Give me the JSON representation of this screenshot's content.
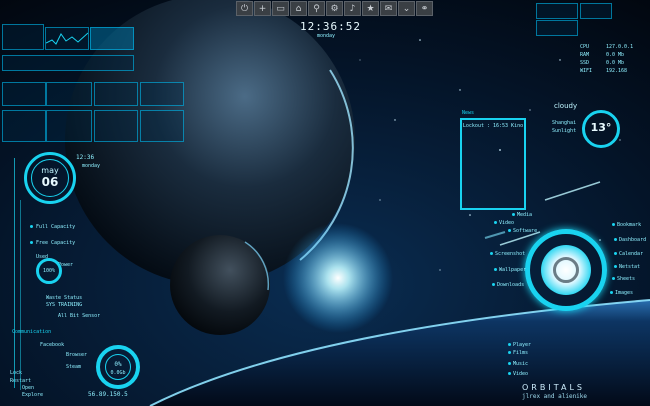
{
  "toolbar": {
    "icons": [
      "power-icon",
      "plus-icon",
      "folder-icon",
      "home-icon",
      "search-icon",
      "gear-icon",
      "music-icon",
      "star-icon",
      "mail-icon",
      "chevron-icon",
      "network-icon"
    ],
    "glyphs": [
      "⏻",
      "+",
      "▭",
      "⌂",
      "⚲",
      "⚙",
      "♪",
      "★",
      "✉",
      "⌄",
      "⚭"
    ]
  },
  "clock": {
    "time": "12:36:52",
    "subtitle": "monday"
  },
  "calendar": {
    "month": "may",
    "day": "06",
    "time_small": "12:36",
    "day_name": "monday"
  },
  "left_menu": {
    "items": [
      "Full Capacity",
      "Free Capacity",
      "Used",
      "Power"
    ],
    "power_percent": "100%",
    "misc": [
      "Waste Status",
      "SYS TRAINING",
      "All Bit Sensor"
    ],
    "communication_label": "Communication",
    "communication_items": [
      "Facebook",
      "Browser",
      "Steam"
    ],
    "extra_items": [
      "Lock",
      "Restart",
      "Open",
      "Explore"
    ],
    "gauge_bottom_percent": "0%",
    "gauge_bottom_sub": "0.0Gb",
    "ip_text": "56.89.150.5"
  },
  "news_panel": {
    "title": "News",
    "text": "Lockout : 16:53 Kino"
  },
  "weather": {
    "condition": "cloudy",
    "temp": "13°",
    "location": "Shanghai",
    "sub": "Sunlight"
  },
  "right_menu": {
    "top_items": [
      "Media",
      "Video",
      "Software",
      "Screenshot",
      "Wallpaper",
      "Downloads"
    ],
    "right_items": [
      "Bookmark",
      "Dashboard",
      "Calendar",
      "Netstat",
      "Sheets",
      "Images"
    ],
    "bottom_items": [
      "Player",
      "Films",
      "Music",
      "Video"
    ]
  },
  "system_top_right": {
    "labels": [
      "CPU",
      "RAM",
      "SSD",
      "WIFI"
    ],
    "values": [
      "127.0.0.1",
      "0.0 Mb",
      "0.0 Mb",
      "192.168"
    ]
  },
  "branding": {
    "title": "ORBITALS",
    "subtitle": "jlrex and alienike"
  },
  "colors": {
    "accent": "#19d3f0",
    "bg": "#020812",
    "glow": "#bdf6ff"
  }
}
